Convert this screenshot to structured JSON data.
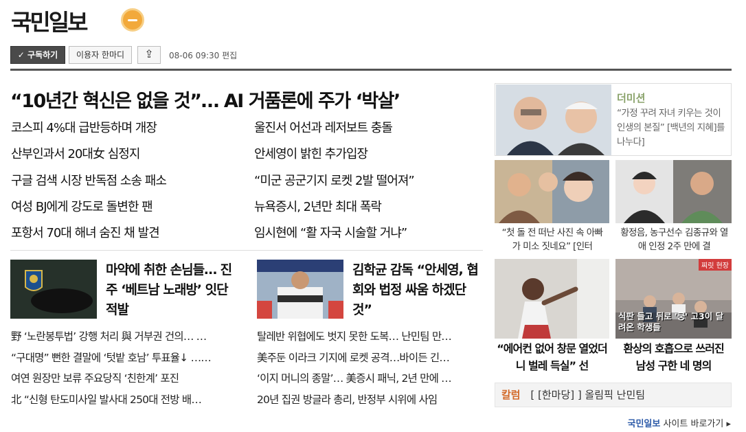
{
  "header": {
    "logo": "국민일보",
    "subscribe": "✓ 구독하기",
    "opinion": "이용자 한마디",
    "edited": "08-06 09:30 편집"
  },
  "main": {
    "headline": "“10년간 혁신은 없을 것”… AI 거품론에 주가 ‘박살’",
    "left_news": [
      "코스피 4%대 급반등하며 개장",
      "산부인과서 20대女 심정지",
      "구글 검색 시장 반독점 소송 패소",
      "여성 BJ에게 강도로 돌변한 팬",
      "포항서 70대 해녀 숨진 채 발견"
    ],
    "right_news": [
      "울진서 어선과 레저보트 충돌",
      "안세영이 밝힌 추가입장",
      "“미군 공군기지 로켓 2발 떨어져”",
      "뉴욕증시, 2년만 최대 폭락",
      "임시현에 “활 자국 시술할 거냐”"
    ]
  },
  "feature1": {
    "title": "마약에 취한 손님들… 진주 ‘베트남 노래방’ 잇단 적발",
    "items": [
      "野 ‘노란봉투법’ 강행 처리 與 거부권 건의… …",
      "“구대명” 뻔한 결말에 ‘텃밭 호남’ 투표율↓ ……",
      "여연 원장만 보류 주요당직 ‘친한계’ 포진",
      "北 “신형 탄도미사일 발사대 250대 전방 배…"
    ]
  },
  "feature2": {
    "title": "김학균 감독 “안세영, 협회와 법정 싸움 하겠단 것”",
    "items": [
      "탈레반 위협에도 벗지 못한 도복… 난민팀 만…",
      "美주둔 이라크 기지에 로켓 공격…바이든 긴…",
      "‘이지 머니의 종말’… 美증시 패닉, 2년 만에 …",
      "20년 집권 방글라 총리, 반정부 시위에 사임"
    ]
  },
  "sidebar": {
    "dimision_label": "더미션",
    "dimision_text": "“가정 꾸려 자녀 키우는 것이 인생의 본질” [백년의 지혜]를 나누다]",
    "card1_caption": "“첫 돌 전 떠난 사진 속 아빠가 미소 짓네요” [인터",
    "card2_caption": "황정음, 농구선수 김종규와 열애 인정 2주 만에 결",
    "card3_caption": "“에어컨 없어 창문 열었더니 벌레 득실” 선",
    "card4_caption": "환상의 호흡으로 쓰러진 남성 구한 네 명의",
    "card4_overlay": "식판 들고 뒤로 '쿵' 고3이 달려온 학생들",
    "card4_tag": "찌릿 현장",
    "column_label": "칼럼",
    "column_text": "[ [한마당] ] 올림픽 난민팀"
  },
  "footer": {
    "label": "국민일보",
    "link": "사이트 바로가기"
  }
}
